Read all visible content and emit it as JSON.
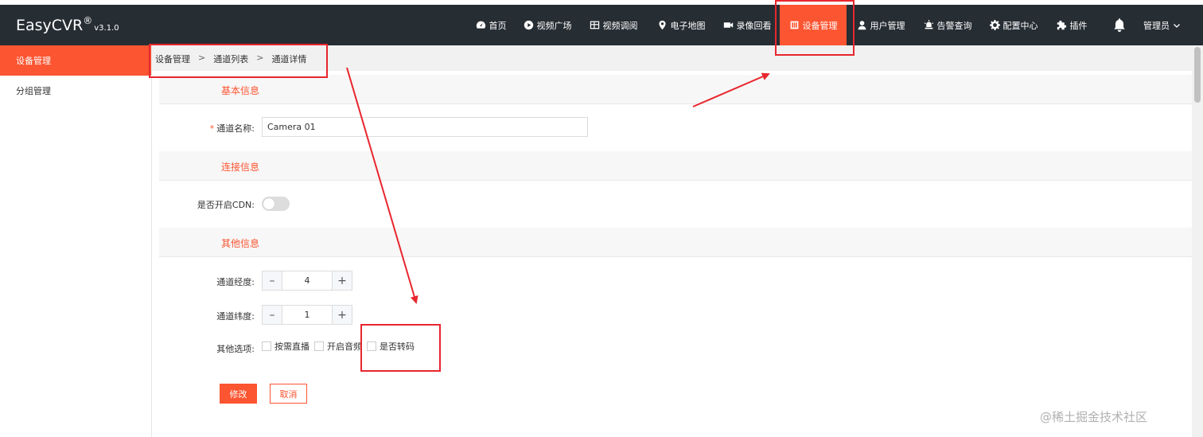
{
  "app": {
    "name": "EasyCVR",
    "reg": "®",
    "version": "v3.1.0"
  },
  "nav": [
    {
      "label": "首页",
      "icon": "dashboard-icon"
    },
    {
      "label": "视频广场",
      "icon": "play-circle-icon"
    },
    {
      "label": "视频调阅",
      "icon": "grid-icon"
    },
    {
      "label": "电子地图",
      "icon": "map-pin-icon"
    },
    {
      "label": "录像回看",
      "icon": "video-camera-icon"
    },
    {
      "label": "设备管理",
      "icon": "device-icon",
      "active": true
    },
    {
      "label": "用户管理",
      "icon": "user-icon"
    },
    {
      "label": "告警查询",
      "icon": "alarm-icon"
    },
    {
      "label": "配置中心",
      "icon": "gear-icon"
    },
    {
      "label": "插件",
      "icon": "puzzle-icon"
    }
  ],
  "user": {
    "name": "管理员"
  },
  "sidebar": {
    "items": [
      {
        "label": "设备管理",
        "active": true
      },
      {
        "label": "分组管理"
      }
    ]
  },
  "breadcrumb": {
    "items": [
      "设备管理",
      "通道列表",
      "通道详情"
    ],
    "sep": ">"
  },
  "form": {
    "sections": {
      "basic": "基本信息",
      "connection": "连接信息",
      "other": "其他信息"
    },
    "channel_name": {
      "label": "通道名称:",
      "required_mark": "*",
      "value": "Camera 01"
    },
    "cdn": {
      "label": "是否开启CDN:",
      "enabled": false
    },
    "longitude": {
      "label": "通道经度:",
      "value": "4",
      "minus": "–",
      "plus": "+"
    },
    "latitude": {
      "label": "通道纬度:",
      "value": "1",
      "minus": "–",
      "plus": "+"
    },
    "options": {
      "label": "其他选项:",
      "items": [
        "按需直播",
        "开启音频",
        "是否转码"
      ]
    },
    "buttons": {
      "submit": "修改",
      "cancel": "取消"
    }
  },
  "watermark": "@稀土掘金技术社区",
  "colors": {
    "accent": "#fc5531",
    "topbar": "#262d33",
    "annotation": "#e8262e"
  }
}
